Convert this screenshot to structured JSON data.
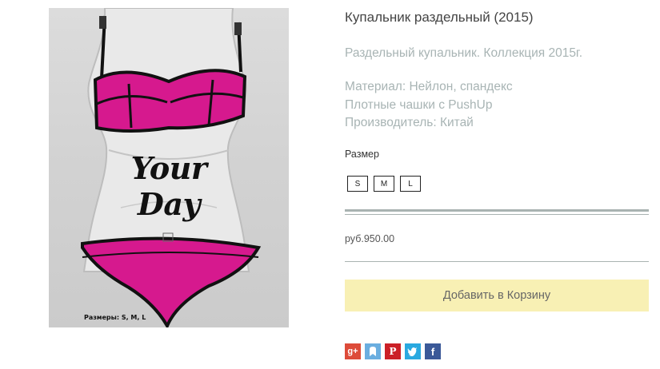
{
  "product": {
    "title": "Купальник раздельный (2015)",
    "image": {
      "brand_text": "Your Day",
      "sizes_caption": "Размеры: S, M, L"
    },
    "description": [
      "Раздельный купальник. Коллекция 2015г.",
      "Материал: Нейлон, спандекс",
      "Плотные чашки с PushUp",
      "Производитель: Китай"
    ],
    "size_label": "Размер",
    "sizes": [
      "S",
      "M",
      "L"
    ],
    "price": "руб.950.00",
    "add_to_cart_label": "Добавить в Корзину"
  },
  "share": [
    {
      "name": "google-plus-icon",
      "glyph": "g+",
      "color": "#dd4b39"
    },
    {
      "name": "bookmark-icon",
      "glyph": "♠",
      "color": "#6aaee0"
    },
    {
      "name": "pinterest-icon",
      "glyph": "P",
      "color": "#cb2027"
    },
    {
      "name": "twitter-icon",
      "glyph": "t",
      "color": "#2aa9e0"
    },
    {
      "name": "facebook-icon",
      "glyph": "f",
      "color": "#3b5998"
    }
  ],
  "colors": {
    "swimsuit": "#d6198e",
    "trim": "#111111",
    "button_bg": "#f8f0b4",
    "muted_text": "#a8b4b4"
  }
}
